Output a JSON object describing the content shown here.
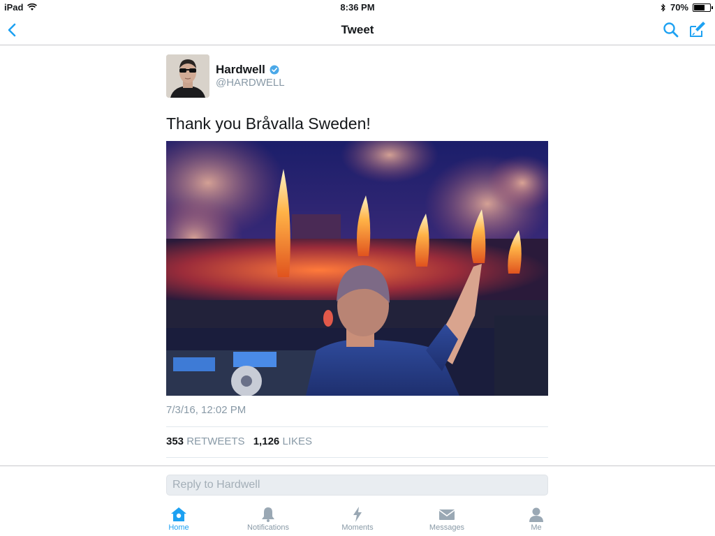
{
  "status_bar": {
    "device": "iPad",
    "time": "8:36 PM",
    "battery_percent": "70%",
    "battery_level": 0.7
  },
  "nav": {
    "title": "Tweet",
    "accent_color": "#1da1f2"
  },
  "tweet": {
    "author_name": "Hardwell",
    "author_handle": "@HARDWELL",
    "verified": true,
    "text": "Thank you Bråvalla Sweden!",
    "timestamp": "7/3/16, 12:02 PM",
    "retweets_count": "353",
    "retweets_label": "RETWEETS",
    "likes_count": "1,126",
    "likes_label": "LIKES"
  },
  "reply": {
    "placeholder": "Reply to Hardwell"
  },
  "tabs": [
    {
      "label": "Home",
      "icon": "home-icon",
      "active": true
    },
    {
      "label": "Notifications",
      "icon": "bell-icon",
      "active": false
    },
    {
      "label": "Moments",
      "icon": "lightning-icon",
      "active": false
    },
    {
      "label": "Messages",
      "icon": "envelope-icon",
      "active": false
    },
    {
      "label": "Me",
      "icon": "person-icon",
      "active": false
    }
  ]
}
